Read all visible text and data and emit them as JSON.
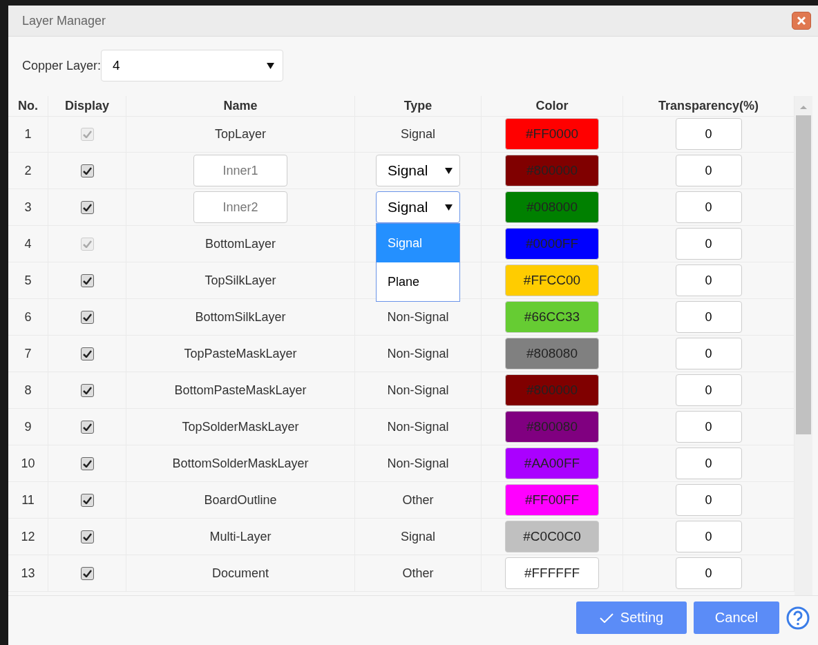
{
  "window": {
    "title": "Layer Manager"
  },
  "copper_layer": {
    "label": "Copper Layer:",
    "value": "4"
  },
  "table": {
    "columns": [
      "No.",
      "Display",
      "Name",
      "Type",
      "Color",
      "Transparency(%)"
    ],
    "rows": [
      {
        "no": "1",
        "kind": "fixed",
        "display": {
          "checked": true,
          "disabled": true
        },
        "name": "TopLayer",
        "type": {
          "value": "Signal"
        },
        "color": "#ff0000",
        "color_text": "#FF0000",
        "transparency": "0"
      },
      {
        "no": "2",
        "kind": "editable",
        "display": {
          "checked": true,
          "disabled": false
        },
        "name": "Inner1",
        "type": {
          "value": "Signal",
          "expanded": false
        },
        "color": "#800000",
        "color_text": "#800000",
        "transparency": "0"
      },
      {
        "no": "3",
        "kind": "editable",
        "display": {
          "checked": true,
          "disabled": false
        },
        "name": "Inner2",
        "type": {
          "value": "Signal",
          "expanded": true,
          "options": [
            {
              "label": "Signal",
              "selected": true
            },
            {
              "label": "Plane",
              "selected": false
            }
          ]
        },
        "color": "#008000",
        "color_text": "#008000",
        "transparency": "0"
      },
      {
        "no": "4",
        "kind": "fixed",
        "display": {
          "checked": true,
          "disabled": true
        },
        "name": "BottomLayer",
        "color": "#0000ff",
        "color_text": "#0000FF",
        "transparency": "0"
      },
      {
        "no": "5",
        "kind": "fixed",
        "display": {
          "checked": true,
          "disabled": false
        },
        "name": "TopSilkLayer",
        "color": "#ffcc00",
        "color_text": "#FFCC00",
        "transparency": "0"
      },
      {
        "no": "6",
        "kind": "fixed",
        "display": {
          "checked": true,
          "disabled": false
        },
        "name": "BottomSilkLayer",
        "type": {
          "value": "Non-Signal"
        },
        "color": "#66cc33",
        "color_text": "#66CC33",
        "transparency": "0"
      },
      {
        "no": "7",
        "kind": "fixed",
        "display": {
          "checked": true,
          "disabled": false
        },
        "name": "TopPasteMaskLayer",
        "type": {
          "value": "Non-Signal"
        },
        "color": "#808080",
        "color_text": "#808080",
        "transparency": "0"
      },
      {
        "no": "8",
        "kind": "fixed",
        "display": {
          "checked": true,
          "disabled": false
        },
        "name": "BottomPasteMaskLayer",
        "type": {
          "value": "Non-Signal"
        },
        "color": "#800000",
        "color_text": "#800000",
        "transparency": "0"
      },
      {
        "no": "9",
        "kind": "fixed",
        "display": {
          "checked": true,
          "disabled": false
        },
        "name": "TopSolderMaskLayer",
        "type": {
          "value": "Non-Signal"
        },
        "color": "#800080",
        "color_text": "#800080",
        "transparency": "0"
      },
      {
        "no": "10",
        "kind": "fixed",
        "display": {
          "checked": true,
          "disabled": false
        },
        "name": "BottomSolderMaskLayer",
        "type": {
          "value": "Non-Signal"
        },
        "color": "#aa00ff",
        "color_text": "#AA00FF",
        "transparency": "0"
      },
      {
        "no": "11",
        "kind": "fixed",
        "display": {
          "checked": true,
          "disabled": false
        },
        "name": "BoardOutline",
        "type": {
          "value": "Other"
        },
        "color": "#ff00ff",
        "color_text": "#FF00FF",
        "transparency": "0"
      },
      {
        "no": "12",
        "kind": "fixed",
        "display": {
          "checked": true,
          "disabled": false
        },
        "name": "Multi-Layer",
        "type": {
          "value": "Signal"
        },
        "color": "#c0c0c0",
        "color_text": "#C0C0C0",
        "transparency": "0"
      },
      {
        "no": "13",
        "kind": "fixed",
        "display": {
          "checked": true,
          "disabled": false
        },
        "name": "Document",
        "type": {
          "value": "Other"
        },
        "color": "#ffffff",
        "color_text": "#FFFFFF",
        "transparency": "0"
      }
    ]
  },
  "buttons": [
    {
      "label": "Setting",
      "kind": "confirm"
    },
    {
      "label": "Cancel",
      "kind": "cancel"
    }
  ]
}
